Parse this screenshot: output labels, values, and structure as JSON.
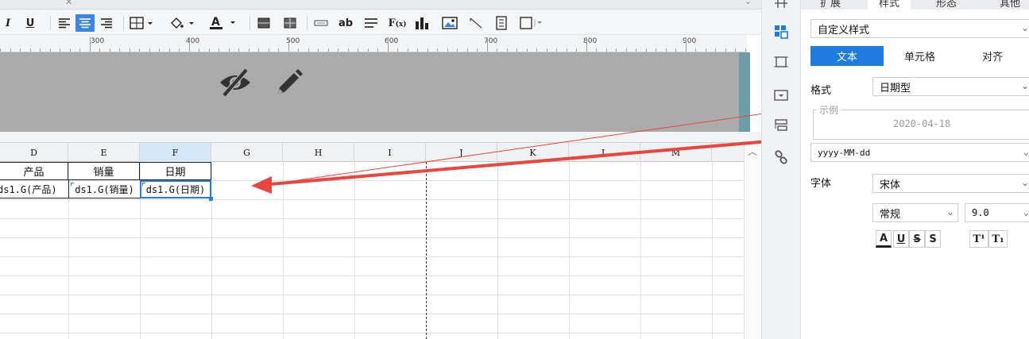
{
  "ruler": {
    "labels": [
      "300",
      "400",
      "500",
      "600",
      "700",
      "800",
      "900"
    ]
  },
  "columns": [
    "D",
    "E",
    "F",
    "G",
    "H",
    "I",
    "J",
    "K",
    "L",
    "M"
  ],
  "table": {
    "headers": [
      "产品",
      "销量",
      "日期"
    ],
    "cells": [
      "ds1.G(产品)",
      "ds1.G(销量)",
      "ds1.G(日期)"
    ]
  },
  "panel": {
    "tabs": [
      "扩展",
      "样式",
      "形态",
      "其他"
    ],
    "style_select": "自定义样式",
    "subtabs": [
      "文本",
      "单元格",
      "对齐"
    ],
    "format_label": "格式",
    "format_value": "日期型",
    "sample_legend": "示例",
    "sample_value": "2020-04-18",
    "pattern_value": "yyyy-MM-dd",
    "font_label": "字体",
    "font_value": "宋体",
    "font_style": "常规",
    "font_size": "9.0",
    "format_buttons": [
      "A",
      "U",
      "S",
      "S",
      "T¹",
      "T₁"
    ]
  },
  "colors": {
    "accent": "#1e7ce0",
    "arrow": "#e8473f",
    "band": "#ababab"
  },
  "icons": {
    "toolbar": [
      "italic-icon",
      "underline-icon",
      "align-left-icon",
      "align-center-icon",
      "align-right-icon",
      "border-icon",
      "fill-color-icon",
      "font-color-icon",
      "merge-icon",
      "unmerge-icon",
      "textbox-icon",
      "ab-icon",
      "text-wrap-icon",
      "formula-icon",
      "chart-icon",
      "image-icon",
      "diagonal-icon",
      "subreport-icon",
      "more-icon"
    ],
    "rail": [
      "cell-element-icon",
      "cell-attribute-icon",
      "border-icon",
      "widget-icon",
      "condition-icon",
      "hyperlink-icon"
    ]
  }
}
